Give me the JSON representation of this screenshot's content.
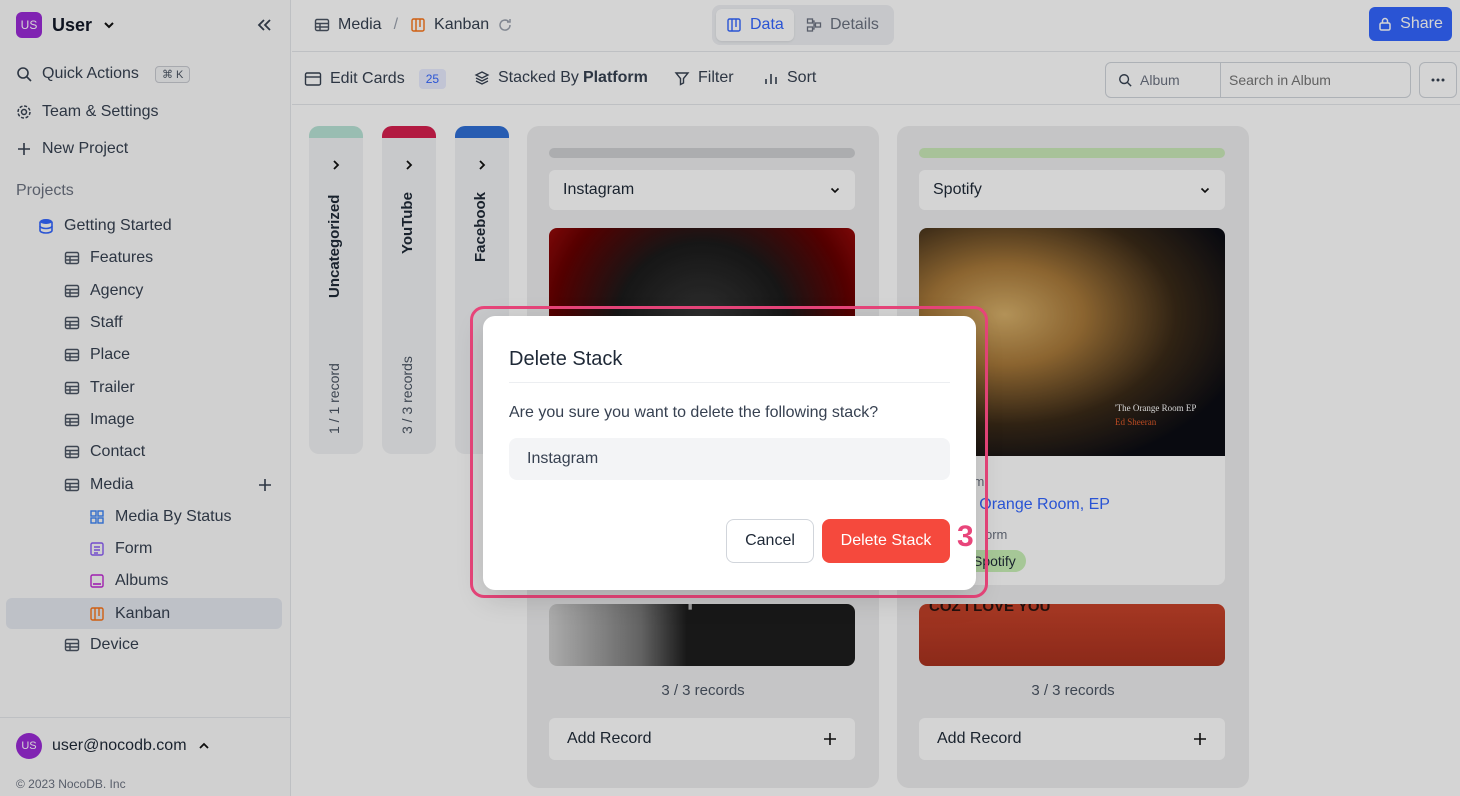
{
  "workspace": {
    "avatar": "US",
    "name": "User"
  },
  "sidebar": {
    "quick_actions": "Quick Actions",
    "shortcut": "⌘ K",
    "team_settings": "Team & Settings",
    "new_project": "New Project",
    "projects_label": "Projects",
    "project_name": "Getting Started",
    "tables": [
      "Features",
      "Agency",
      "Staff",
      "Place",
      "Trailer",
      "Image",
      "Contact",
      "Media"
    ],
    "views": [
      "Media By Status",
      "Form",
      "Albums",
      "Kanban"
    ],
    "device": "Device",
    "user_avatar": "US",
    "user_email": "user@nocodb.com",
    "copyright": "© 2023 NocoDB. Inc"
  },
  "topbar": {
    "crumb_table": "Media",
    "crumb_sep": "/",
    "crumb_view": "Kanban",
    "tab_data": "Data",
    "tab_details": "Details",
    "share": "Share"
  },
  "toolbar": {
    "edit_cards": "Edit Cards",
    "edit_count": "25",
    "stacked_by": "Stacked By",
    "stacked_field": "Platform",
    "filter": "Filter",
    "sort": "Sort",
    "search_field": "Album",
    "search_placeholder": "Search in Album"
  },
  "board": {
    "collapsed": [
      {
        "label": "Uncategorized",
        "count": "1 / 1 record",
        "color": "#b8e4d6"
      },
      {
        "label": "YouTube",
        "count": "3 / 3 records",
        "color": "#d6204f"
      },
      {
        "label": "Facebook",
        "count": "",
        "color": "#2f6fd6"
      }
    ],
    "stacks": [
      {
        "name": "Instagram",
        "bar_color": "#cfd0d3",
        "records": "3 / 3 records",
        "add": "Add Record"
      },
      {
        "name": "Spotify",
        "bar_color": "#cbeab9",
        "records": "3 / 3 records",
        "add": "Add Record",
        "card": {
          "image_title": "'The Orange Room EP",
          "image_artist": "Ed Sheeran",
          "album_label": "bum",
          "album_value": "he Orange Room, EP",
          "platform_label": "orm",
          "platform_tag": "Spotify"
        },
        "next_card_text": "COZ I LOVE YOU"
      }
    ],
    "instagram_next_text": "TE"
  },
  "modal": {
    "title": "Delete Stack",
    "message": "Are you sure you want to delete the following stack?",
    "stack_name": "Instagram",
    "cancel": "Cancel",
    "confirm": "Delete Stack"
  },
  "annotation": {
    "step": "3"
  },
  "colors": {
    "accent": "#3366ff",
    "danger": "#f5493d",
    "highlight": "#e8457a",
    "workspace": "#9b2bd6"
  }
}
